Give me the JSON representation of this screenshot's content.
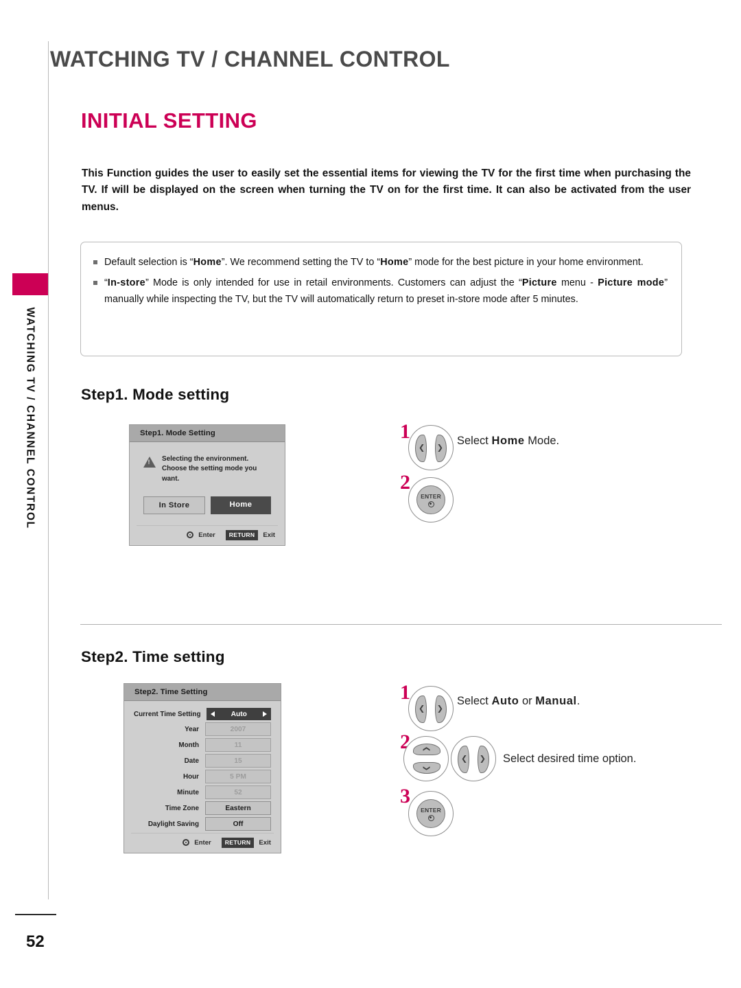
{
  "chapter": {
    "title": "WATCHING TV / CHANNEL CONTROL"
  },
  "sidebar": {
    "label": "WATCHING TV / CHANNEL CONTROL",
    "tab_color": "#cc0055"
  },
  "heading": "INITIAL SETTING",
  "intro": "This Function guides the user to easily set the essential items for viewing the TV for the first time when purchasing the TV. If will be displayed on the screen when turning the TV on for the first time. It can also be activated from the user menus.",
  "notes": [
    {
      "p1": "Default selection is “",
      "b1": "Home",
      "p2": "”. We recommend setting the TV to “",
      "b2": "Home",
      "p3": "” mode for the best picture in your home environment."
    },
    {
      "p1": "“",
      "b1": "In-store",
      "p2": "” Mode is only intended for use in retail environments. Customers can adjust the “",
      "b2": "Picture",
      "p3": " menu - ",
      "b3": "Picture mode",
      "p4": "” manually while inspecting the TV, but the TV will automatically return to preset in-store mode after 5 minutes."
    }
  ],
  "step1": {
    "heading": "Step1. Mode setting",
    "osd": {
      "title": "Step1. Mode Setting",
      "warn_line1": "Selecting the environment.",
      "warn_line2": "Choose the setting mode you want.",
      "btn_instore": "In Store",
      "btn_home": "Home",
      "footer_enter": "Enter",
      "footer_return": "RETURN",
      "footer_exit": "Exit"
    },
    "steps": [
      {
        "num": "1",
        "text_pre": "Select ",
        "text_bold": "Home",
        "text_post": " Mode."
      },
      {
        "num": "2",
        "text_pre": "",
        "text_bold": "",
        "text_post": ""
      }
    ],
    "enter_label": "ENTER"
  },
  "step2": {
    "heading": "Step2. Time setting",
    "osd": {
      "title": "Step2. Time Setting",
      "rows": [
        {
          "label": "Current Time Setting",
          "value": "Auto",
          "state": "hl"
        },
        {
          "label": "Year",
          "value": "2007",
          "state": "dim"
        },
        {
          "label": "Month",
          "value": "11",
          "state": "dim"
        },
        {
          "label": "Date",
          "value": "15",
          "state": "dim"
        },
        {
          "label": "Hour",
          "value": "5 PM",
          "state": "dim"
        },
        {
          "label": "Minute",
          "value": "52",
          "state": "dim"
        },
        {
          "label": "Time Zone",
          "value": "Eastern",
          "state": "act"
        },
        {
          "label": "Daylight Saving",
          "value": "Off",
          "state": "act"
        }
      ],
      "footer_enter": "Enter",
      "footer_return": "RETURN",
      "footer_exit": "Exit"
    },
    "steps": [
      {
        "num": "1"
      },
      {
        "num": "2"
      },
      {
        "num": "3"
      }
    ],
    "instr1_pre": "Select ",
    "instr1_b1": "Auto",
    "instr1_mid": " or ",
    "instr1_b2": "Manual",
    "instr1_post": ".",
    "instr2": "Select desired time option.",
    "enter_label": "ENTER"
  },
  "footer": {
    "page_number": "52"
  }
}
